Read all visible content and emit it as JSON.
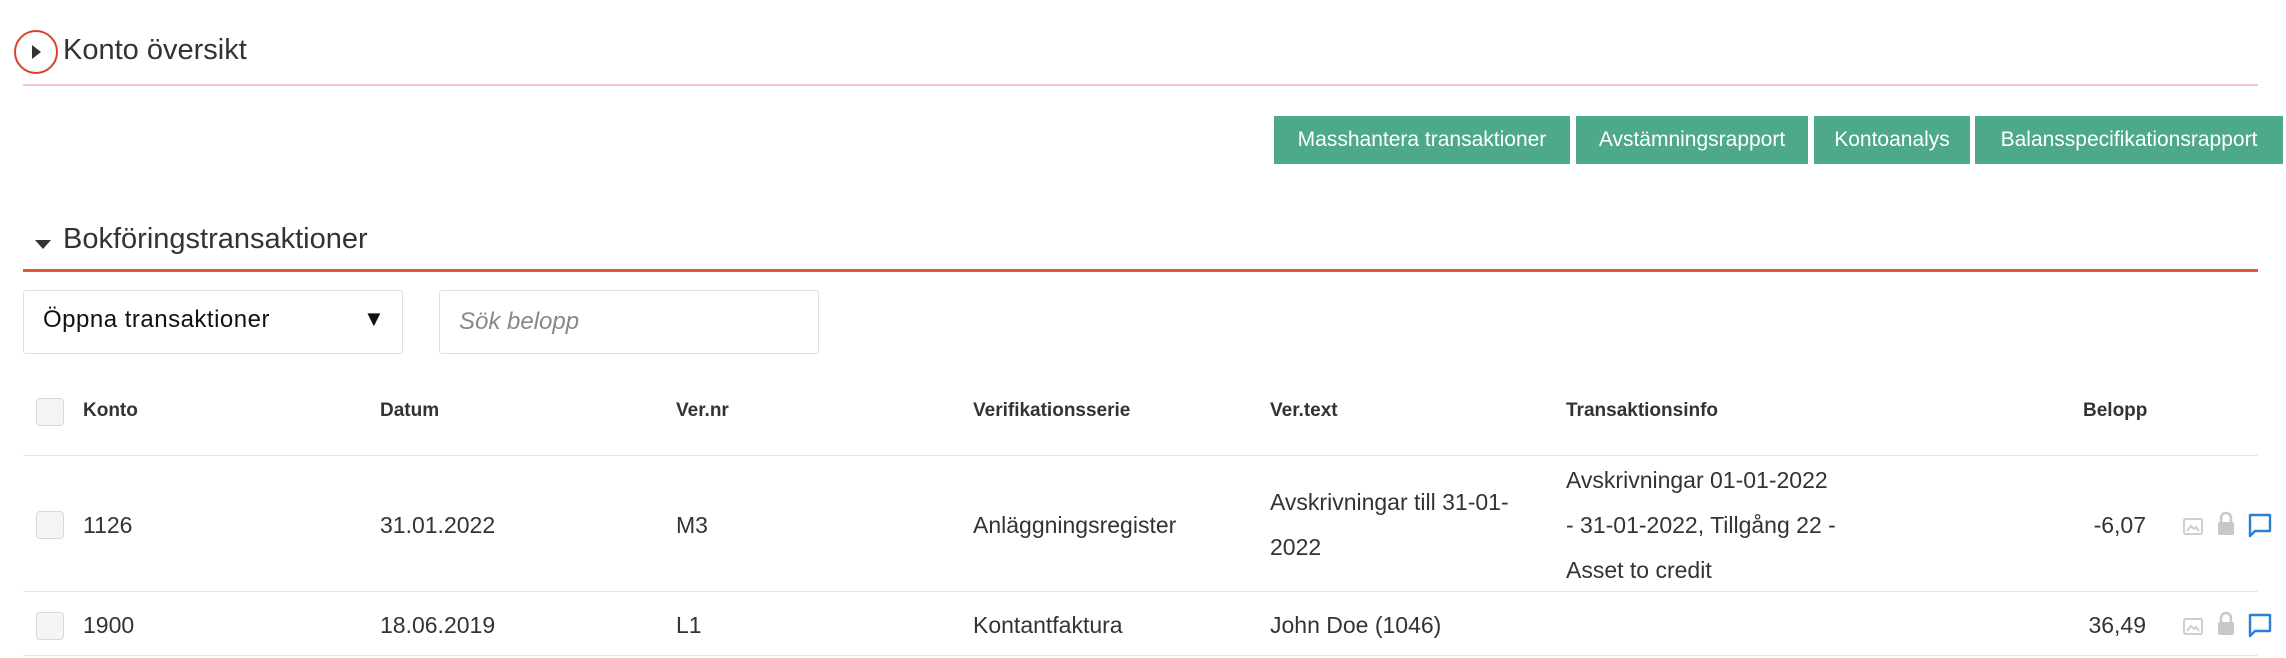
{
  "overview": {
    "title": "Konto översikt",
    "buttons": {
      "mass": "Masshantera transaktioner",
      "reconcile": "Avstämningsrapport",
      "analysis": "Kontoanalys",
      "balance": "Balansspecifikationsrapport"
    }
  },
  "transactions": {
    "title": "Bokföringstransaktioner",
    "filter_value": "Öppna transaktioner",
    "search_placeholder": "Sök belopp",
    "columns": {
      "account": "Konto",
      "date": "Datum",
      "vernr": "Ver.nr",
      "series": "Verifikationsserie",
      "vertext": "Ver.text",
      "info": "Transaktionsinfo",
      "amount": "Belopp"
    },
    "rows": [
      {
        "account": "1126",
        "date": "31.01.2022",
        "vernr": "M3",
        "series": "Anläggningsregister",
        "vertext_l1": "Avskrivningar till 31-01-",
        "vertext_l2": "2022",
        "info_l1": "Avskrivningar 01-01-2022",
        "info_l2": "- 31-01-2022, Tillgång 22 -",
        "info_l3": "Asset to credit",
        "amount": "-6,07"
      },
      {
        "account": "1900",
        "date": "18.06.2019",
        "vernr": "L1",
        "series": "Kontantfaktura",
        "vertext": "John Doe (1046)",
        "info": "",
        "amount": "36,49"
      }
    ]
  },
  "colors": {
    "button": "#4ea88a",
    "accent_line": "#e25a2a",
    "highlight_circle": "#d9412e",
    "comment_icon": "#2a7fd4"
  },
  "icons": [
    "caret-right-icon",
    "caret-down-icon",
    "image-icon",
    "lock-icon",
    "comment-icon"
  ]
}
